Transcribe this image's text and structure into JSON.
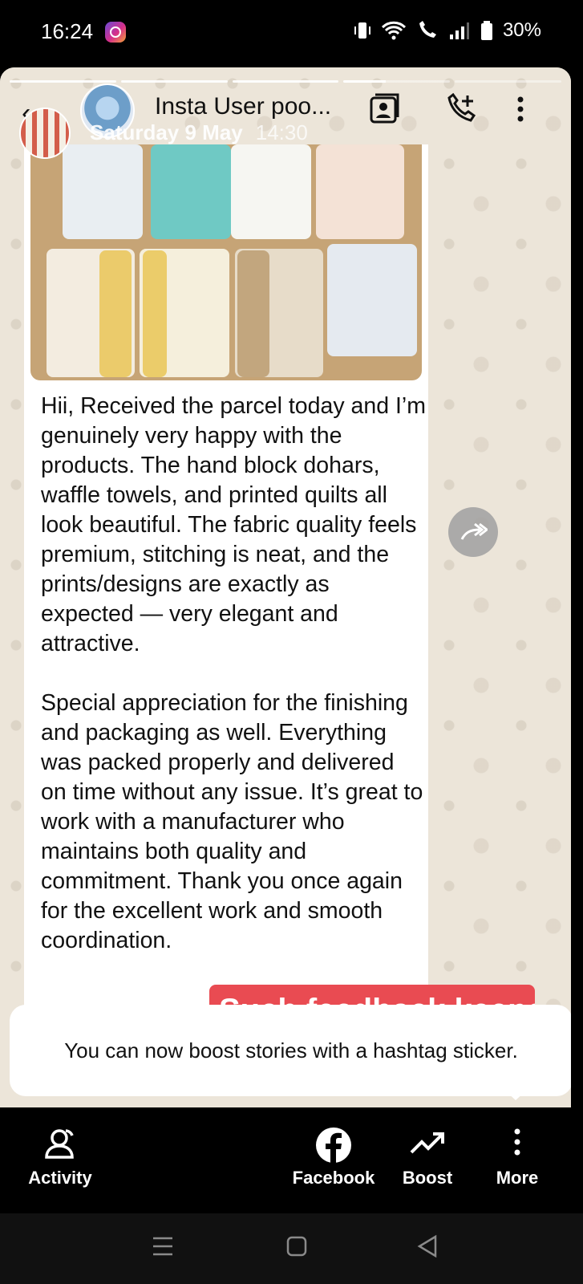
{
  "status_bar": {
    "time": "16:24",
    "notification_icon": "instagram-icon",
    "battery": "30%"
  },
  "story": {
    "header": {
      "user_name": "Insta User poo...",
      "date": "Saturday 9 May",
      "time": "14:30",
      "icons": [
        "saved-story-icon",
        "phone-add-icon",
        "more-vertical-icon"
      ]
    },
    "message": {
      "photo_icon": "product-photo",
      "text": "Hii, Received the parcel today and I’m genuinely very happy with the products. The hand block dohars, waffle towels, and printed quilts all look beautiful. The fabric quality feels premium, stitching is neat, and the prints/designs are exactly as expected — very elegant and attractive.\n\nSpecial appreciation for the finishing and packaging as well. Everything was packed properly and delivered on time without any issue. It’s great to work with a manufacturer who maintains both quality and commitment. Thank you once again for the excellent work and smooth coordination."
    },
    "sticker_text": "Such feedback keeps us",
    "tooltip": "You can now boost stories with a hashtag sticker."
  },
  "action_bar": {
    "activity": "Activity",
    "facebook": "Facebook",
    "boost": "Boost",
    "more": "More"
  },
  "colors": {
    "sticker_red": "#e94b52",
    "chat_bg": "#ece5d9"
  }
}
